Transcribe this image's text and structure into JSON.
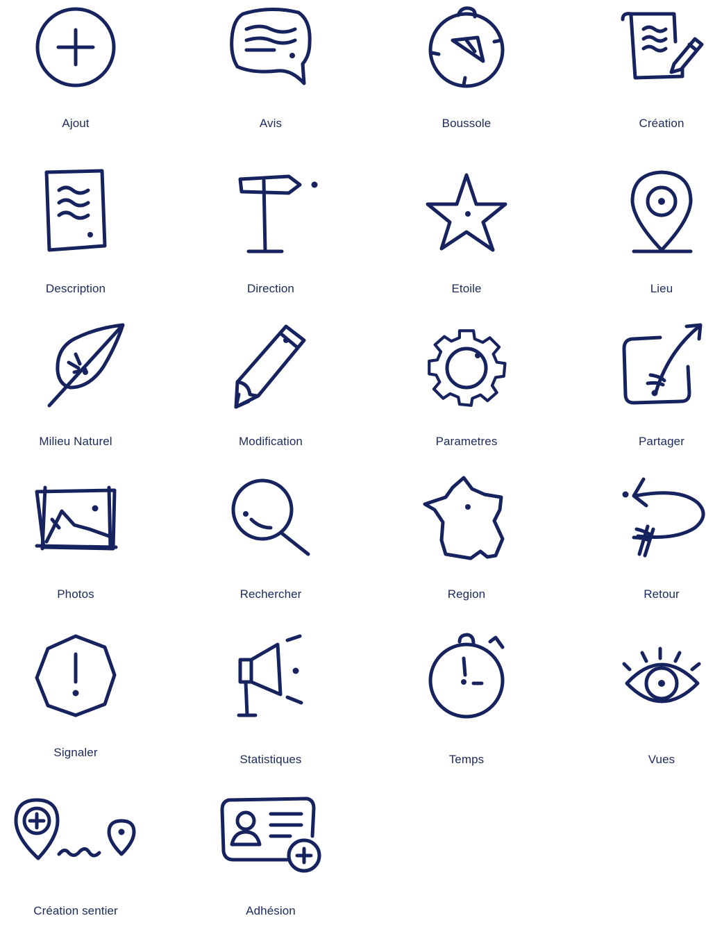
{
  "colors": {
    "icon_stroke": "#17235f",
    "label_text": "#1b2a5c",
    "background": "#ffffff"
  },
  "icons": [
    {
      "icon": "plus-circle-icon",
      "label": "Ajout"
    },
    {
      "icon": "speech-bubble-icon",
      "label": "Avis"
    },
    {
      "icon": "compass-icon",
      "label": "Boussole"
    },
    {
      "icon": "scroll-pen-icon",
      "label": "Création"
    },
    {
      "icon": "document-icon",
      "label": "Description"
    },
    {
      "icon": "signpost-icon",
      "label": "Direction"
    },
    {
      "icon": "star-icon",
      "label": "Etoile"
    },
    {
      "icon": "map-pin-icon",
      "label": "Lieu"
    },
    {
      "icon": "leaf-icon",
      "label": "Milieu Naturel"
    },
    {
      "icon": "pencil-icon",
      "label": "Modification"
    },
    {
      "icon": "gear-icon",
      "label": "Parametres"
    },
    {
      "icon": "share-arrow-icon",
      "label": "Partager"
    },
    {
      "icon": "image-icon",
      "label": "Photos"
    },
    {
      "icon": "magnifier-icon",
      "label": "Rechercher"
    },
    {
      "icon": "france-map-icon",
      "label": "Region"
    },
    {
      "icon": "return-arrow-icon",
      "label": "Retour"
    },
    {
      "icon": "warning-octagon-icon",
      "label": "Signaler"
    },
    {
      "icon": "megaphone-icon",
      "label": "Statistiques"
    },
    {
      "icon": "stopwatch-icon",
      "label": "Temps"
    },
    {
      "icon": "eye-icon",
      "label": "Vues"
    },
    {
      "icon": "trail-creation-icon",
      "label": "Création sentier"
    },
    {
      "icon": "membership-card-icon",
      "label": "Adhésion"
    }
  ]
}
